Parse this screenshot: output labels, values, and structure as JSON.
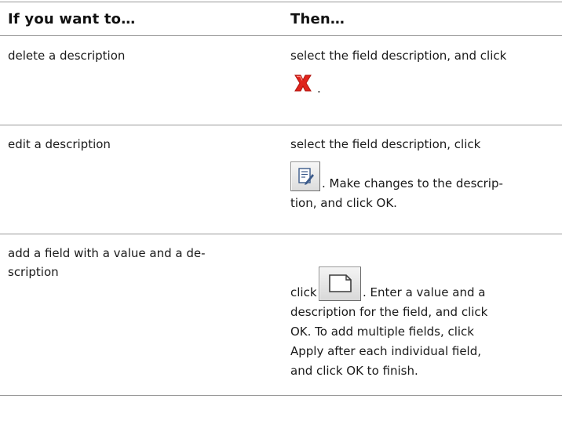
{
  "header": {
    "col1": "If you want to…",
    "col2": "Then…"
  },
  "rows": [
    {
      "want": "delete a description",
      "then_before": "select the field description, and click",
      "then_after": "."
    },
    {
      "want": "edit a description",
      "then_before": "select the field description, click",
      "then_after": ". Make changes to the descrip-",
      "then_line3": "tion, and click OK."
    },
    {
      "want_line1": "add a field with a value and a de-",
      "want_line2": "scription",
      "then_before": "click",
      "then_after": ". Enter a value and a",
      "then_line2": "description for the field, and click",
      "then_line3": "OK. To add multiple fields, click",
      "then_line4": "Apply after each individual field,",
      "then_line5": "and click OK to finish."
    }
  ],
  "icons": {
    "delete": "delete-x-icon",
    "edit": "edit-description-icon",
    "add": "new-field-icon"
  },
  "colors": {
    "delete_red": "#e0241c",
    "rule": "#9a9a9a"
  }
}
